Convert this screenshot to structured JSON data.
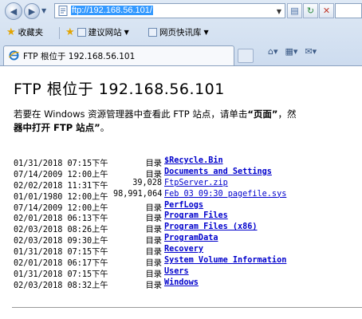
{
  "address": {
    "url": "ftp://192.168.56.101/"
  },
  "favorites": {
    "label": "收藏夹",
    "items": [
      {
        "label": "建议网站"
      },
      {
        "label": "网页快讯库"
      }
    ]
  },
  "tab": {
    "title": "FTP 根位于 192.168.56.101"
  },
  "page": {
    "heading": "FTP 根位于 192.168.56.101",
    "intro_line1_a": "若要在 Windows 资源管理器中查看此 FTP 站点，请单击",
    "intro_line1_b": "“页面”",
    "intro_line1_c": "，然",
    "intro_line2": "器中打开 FTP 站点”。",
    "intro_line2_bold": "器中打开 FTP 站点”",
    "intro_line2_tail": "。"
  },
  "listing": [
    {
      "date": "01/31/2018 07:15下午",
      "size": "目录",
      "name": "$Recycle.Bin",
      "dir": true
    },
    {
      "date": "07/14/2009 12:00上午",
      "size": "目录",
      "name": "Documents and Settings",
      "dir": true
    },
    {
      "date": "02/02/2018 11:31下午",
      "size": "39,028",
      "name": "FtpServer.zip",
      "dir": false
    },
    {
      "date": "01/01/1980 12:00上午",
      "size": "98,991,064",
      "name": "Feb 03 09:30 pagefile.sys",
      "dir": false
    },
    {
      "date": "07/14/2009 12:00上午",
      "size": "目录",
      "name": "PerfLogs",
      "dir": true
    },
    {
      "date": "02/01/2018 06:13下午",
      "size": "目录",
      "name": "Program Files",
      "dir": true
    },
    {
      "date": "02/03/2018 08:26上午",
      "size": "目录",
      "name": "Program Files (x86)",
      "dir": true
    },
    {
      "date": "02/03/2018 09:30上午",
      "size": "目录",
      "name": "ProgramData",
      "dir": true
    },
    {
      "date": "01/31/2018 07:15下午",
      "size": "目录",
      "name": "Recovery",
      "dir": true
    },
    {
      "date": "02/01/2018 06:17下午",
      "size": "目录",
      "name": "System Volume Information",
      "dir": true
    },
    {
      "date": "01/31/2018 07:15下午",
      "size": "目录",
      "name": "Users",
      "dir": true
    },
    {
      "date": "02/03/2018 08:32上午",
      "size": "目录",
      "name": "Windows",
      "dir": true
    }
  ],
  "colors": {
    "link": "#0000cc",
    "chrome": "#dfe9f5",
    "selection": "#3399ff"
  },
  "icons": [
    "back-arrow-icon",
    "forward-arrow-icon",
    "ie-page-icon",
    "compat-view-icon",
    "refresh-icon",
    "stop-icon",
    "star-icon",
    "home-icon",
    "feeds-icon",
    "mail-icon"
  ]
}
